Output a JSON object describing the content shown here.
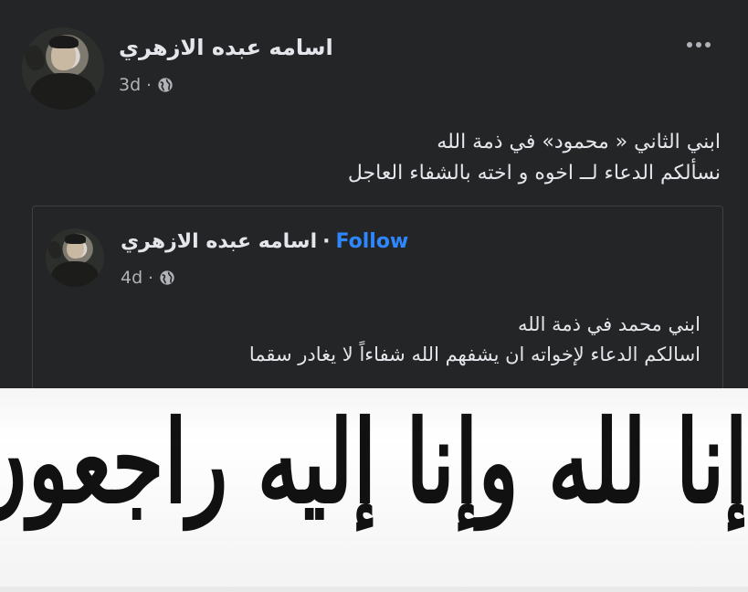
{
  "post": {
    "author": "اسامه عبده الازهري",
    "time": "3d",
    "separator": "·",
    "privacy_icon": "globe-icon",
    "more_icon": "more-horizontal-icon",
    "text_line1": "ابني الثاني « محمود»  في ذمة الله",
    "text_line2": "نسألكم الدعاء لــ اخوه و اخته بالشفاء العاجل"
  },
  "shared_post": {
    "author": "اسامه عبده الازهري",
    "separator": "·",
    "follow_label": "Follow",
    "time": "4d",
    "privacy_icon": "globe-icon",
    "text_line1": "ابني محمد في ذمة الله",
    "text_line2": "اسالكم الدعاء لإخواته ان يشفهم الله شفاءاً لا يغادر سقما"
  },
  "banner": {
    "text": "إنا لله وإنا إليه راجعون"
  },
  "colors": {
    "background": "#242526",
    "text": "#e4e6eb",
    "secondary_text": "#b0b3b8",
    "link": "#2d88ff",
    "banner_bg": "#ffffff"
  }
}
